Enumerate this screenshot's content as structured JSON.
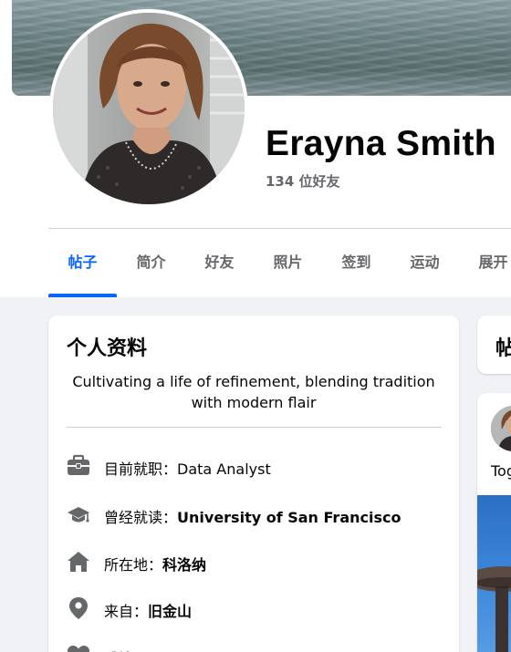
{
  "profile": {
    "name": "Erayna Smith",
    "friends_count": "134 位好友"
  },
  "tabs": [
    {
      "label": "帖子",
      "active": true
    },
    {
      "label": "简介",
      "active": false
    },
    {
      "label": "好友",
      "active": false
    },
    {
      "label": "照片",
      "active": false
    },
    {
      "label": "签到",
      "active": false
    },
    {
      "label": "运动",
      "active": false
    },
    {
      "label": "展开",
      "active": false
    }
  ],
  "intro": {
    "title": "个人资料",
    "bio": "Cultivating a life of refinement, blending tradition with modern flair",
    "items": [
      {
        "icon": "briefcase-icon",
        "prefix": "目前就职：",
        "value": "Data Analyst",
        "value_bold": false
      },
      {
        "icon": "graduation-cap-icon",
        "prefix": "曾经就读：",
        "value": "University of San Francisco",
        "value_bold": true
      },
      {
        "icon": "home-icon",
        "prefix": "所在地：",
        "value": "科洛纳",
        "value_bold": true
      },
      {
        "icon": "location-pin-icon",
        "prefix": "来自：",
        "value": "旧金山",
        "value_bold": true
      },
      {
        "icon": "heart-icon",
        "prefix": "感情",
        "value": "",
        "value_bold": false
      }
    ]
  },
  "posts": {
    "title": "帖子",
    "preview_text": "Together"
  },
  "colors": {
    "accent": "#0866ff",
    "secondary_text": "#65676b",
    "icon_gray": "#65676b",
    "page_background": "#f0f2f5"
  }
}
